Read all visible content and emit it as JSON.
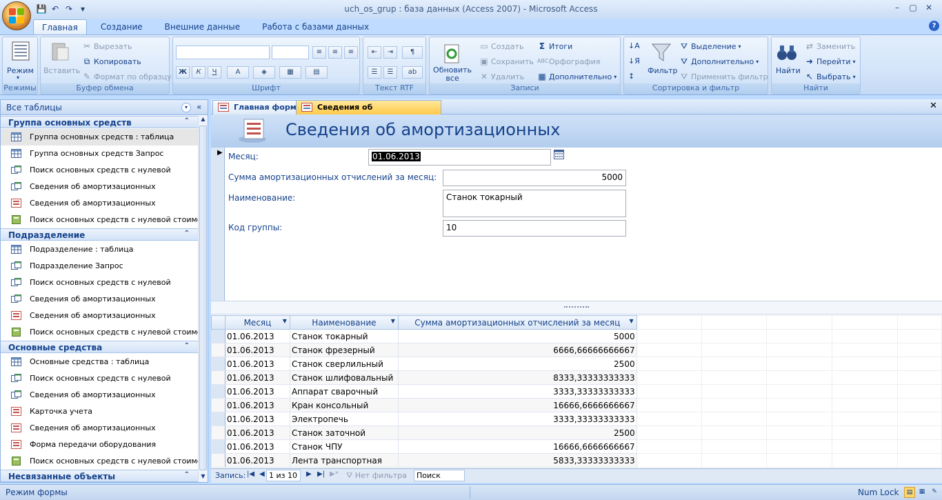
{
  "window": {
    "title": "uch_os_grup : база данных (Access 2007) - Microsoft Access",
    "min": "–",
    "max": "▢",
    "close": "✕"
  },
  "qat": {
    "save": "💾",
    "undo": "↶",
    "redo": "↷",
    "customize": "▾"
  },
  "ribbon_tabs": [
    "Главная",
    "Создание",
    "Внешние данные",
    "Работа с базами данных"
  ],
  "help": "?",
  "ribbon": {
    "views": {
      "label": "Режим",
      "group": "Режимы"
    },
    "clipboard": {
      "paste": "Вставить",
      "cut": "Вырезать",
      "copy": "Копировать",
      "format_painter": "Формат по образцу",
      "group": "Буфер обмена"
    },
    "font": {
      "group": "Шрифт",
      "bold": "Ж",
      "italic": "К",
      "underline": "Ч",
      "font_color": "A"
    },
    "rtf": {
      "group": "Текст RTF"
    },
    "records": {
      "refresh": "Обновить все",
      "new": "Создать",
      "save": "Сохранить",
      "delete": "Удалить",
      "totals": "Итоги",
      "spelling": "Орфография",
      "more": "Дополнительно",
      "group": "Записи"
    },
    "sort": {
      "filter": "Фильтр",
      "selection": "Выделение",
      "advanced": "Дополнительно",
      "toggle": "Применить фильтр",
      "group": "Сортировка и фильтр"
    },
    "find": {
      "find": "Найти",
      "replace": "Заменить",
      "goto": "Перейти",
      "select": "Выбрать",
      "group": "Найти"
    }
  },
  "nav": {
    "title": "Все таблицы",
    "groups": [
      {
        "name": "Группа основных средств",
        "items": [
          "Группа основных средств : таблица",
          "Группа основных средств Запрос",
          "Поиск основных средств с нулевой",
          "Сведения об амортизационных",
          "Сведения об амортизационных",
          "Поиск основных средств с нулевой стоимо..."
        ]
      },
      {
        "name": "Подразделение",
        "items": [
          "Подразделение : таблица",
          "Подразделение Запрос",
          "Поиск основных средств с нулевой",
          "Сведения об амортизационных",
          "Сведения об амортизационных",
          "Поиск основных средств с нулевой стоимо..."
        ]
      },
      {
        "name": "Основные средства",
        "items": [
          "Основные средства : таблица",
          "Поиск основных средств с нулевой",
          "Сведения об амортизационных",
          "Карточка учета",
          "Сведения об амортизационных",
          "Форма передачи оборудования",
          "Поиск основных средств с нулевой стоимо..."
        ]
      },
      {
        "name": "Несвязанные объекты",
        "items": []
      }
    ]
  },
  "doc_tabs": [
    "Главная форма",
    "Сведения об амортизационных"
  ],
  "form": {
    "caption": "Сведения об амортизационных",
    "month_label": "Месяц:",
    "month_value": "01.06.2013",
    "sum_label": "Сумма амортизационных отчислений за месяц:",
    "sum_value": "5000",
    "name_label": "Наименование:",
    "name_value": "Станок токарный",
    "code_label": "Код группы:",
    "code_value": "10"
  },
  "datasheet": {
    "columns": [
      "Месяц",
      "Наименование",
      "Сумма амортизационных отчислений за месяц"
    ],
    "rows": [
      [
        "01.06.2013",
        "Станок токарный",
        "5000"
      ],
      [
        "01.06.2013",
        "Станок фрезерный",
        "6666,66666666667"
      ],
      [
        "01.06.2013",
        "Станок сверлильный",
        "2500"
      ],
      [
        "01.06.2013",
        "Станок шлифовальный",
        "8333,33333333333"
      ],
      [
        "01.06.2013",
        "Аппарат сварочный",
        "3333,33333333333"
      ],
      [
        "01.06.2013",
        "Кран консольный",
        "16666,6666666667"
      ],
      [
        "01.06.2013",
        "Электропечь",
        "3333,33333333333"
      ],
      [
        "01.06.2013",
        "Станок заточной",
        "2500"
      ],
      [
        "01.06.2013",
        "Станок ЧПУ",
        "16666,6666666667"
      ],
      [
        "01.06.2013",
        "Лента транспортная",
        "5833,33333333333"
      ]
    ]
  },
  "record_nav": {
    "label": "Запись:",
    "position": "1 из 10",
    "filter": "Нет фильтра",
    "search": "Поиск"
  },
  "status": {
    "left": "Режим формы",
    "numlock": "Num Lock"
  }
}
